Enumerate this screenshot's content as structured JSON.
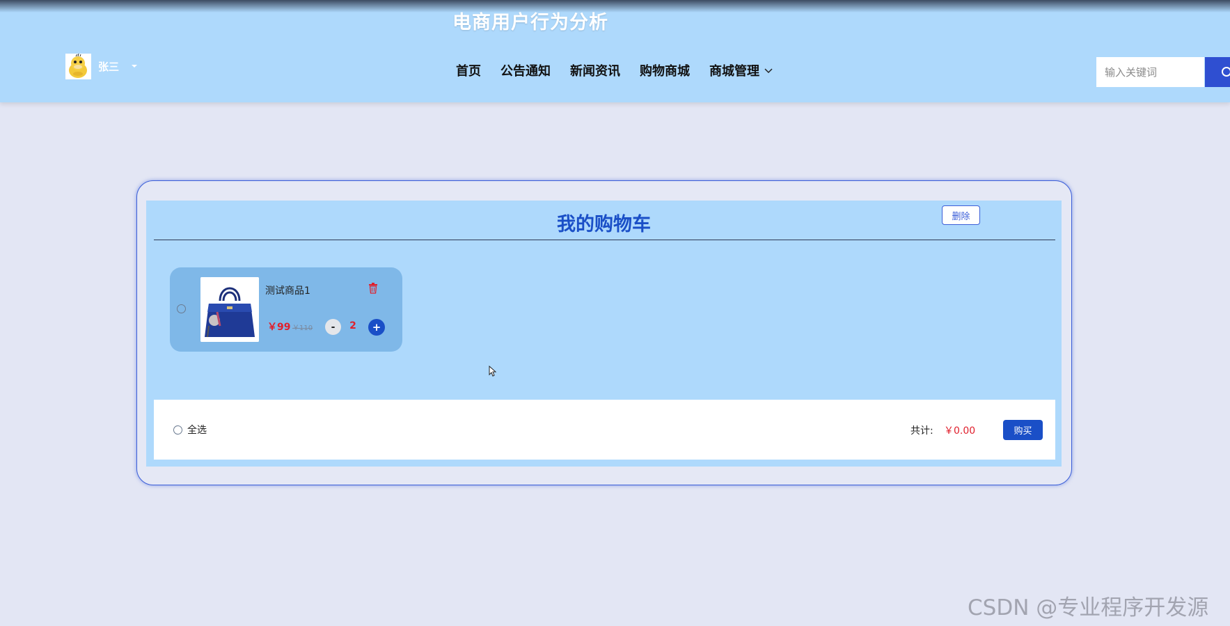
{
  "header": {
    "site_title": "电商用户行为分析",
    "user_name": "张三",
    "nav_items": [
      {
        "label": "首页"
      },
      {
        "label": "公告通知"
      },
      {
        "label": "新闻资讯"
      },
      {
        "label": "购物商城"
      },
      {
        "label": "商城管理"
      }
    ],
    "search_placeholder": "输入关键词"
  },
  "cart": {
    "title": "我的购物车",
    "delete_label": "删除",
    "items": [
      {
        "name": "测试商品1",
        "price": "￥99",
        "original_price": "￥110",
        "quantity": "2",
        "minus_label": "-",
        "plus_label": "+"
      }
    ],
    "footer": {
      "select_all_label": "全选",
      "total_label": "共计:",
      "total_value": "￥0.00",
      "buy_label": "购买"
    }
  },
  "watermark": "CSDN @专业程序开发源",
  "colors": {
    "header_bg": "#aed9fc",
    "page_bg": "#e3e6f4",
    "accent_blue": "#1a4fc7",
    "price_red": "#e0202d",
    "item_card_bg": "#7fb8e8"
  }
}
